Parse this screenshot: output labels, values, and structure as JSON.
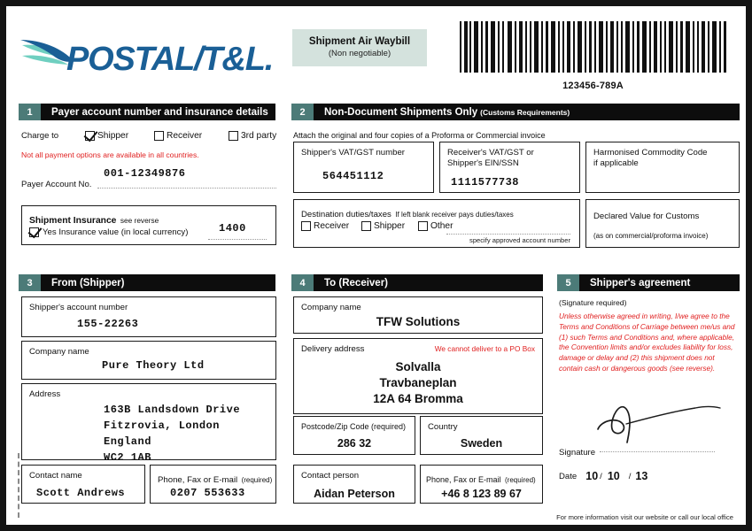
{
  "brand": {
    "name": "POSTAL/T&L.",
    "logo_icon": "wing-logo-icon",
    "blue": "#1a5f96",
    "teal": "#5ec4b6"
  },
  "header": {
    "badge_title": "Shipment Air Waybill",
    "badge_subtitle": "(Non negotiable)",
    "barcode_icon": "barcode-icon",
    "barcode_number": "123456-789A"
  },
  "colors": {
    "section_number_bg": "#4c7b78",
    "section_bar_bg": "#0d0d0d",
    "badge_bg": "#d4e2dd",
    "warning_red": "#e02020"
  },
  "section1": {
    "number": "1",
    "title": "Payer account number and insurance details",
    "charge_to_label": "Charge to",
    "charge_options": [
      {
        "label": "Shipper",
        "checked": true
      },
      {
        "label": "Receiver",
        "checked": false
      },
      {
        "label": "3rd party",
        "checked": false
      }
    ],
    "warning": "Not all payment options are available in all countries.",
    "payer_account_label": "Payer Account No.",
    "payer_account_value": "001-12349876",
    "insurance_title": "Shipment Insurance",
    "insurance_title_sub": "see reverse",
    "insurance_checkbox_checked": true,
    "insurance_option_label": "Yes Insurance value (in local currency)",
    "insurance_value": "1400"
  },
  "section2": {
    "number": "2",
    "title": "Non-Document Shipments Only",
    "title_sub": "(Customs Requirements)",
    "instruction": "Attach the original and four copies of a Proforma or Commercial invoice",
    "shipper_vat_label": "Shipper's VAT/GST number",
    "shipper_vat_value": "564451112",
    "receiver_vat_label_line1": "Receiver's VAT/GST or",
    "receiver_vat_label_line2": "Shipper's EIN/SSN",
    "receiver_vat_value": "1111577738",
    "commodity_label_line1": "Harmonised Commodity Code",
    "commodity_label_line2": "if applicable",
    "commodity_value": "",
    "duties_label": "Destination duties/taxes",
    "duties_label_sub": "If left blank receiver pays duties/taxes",
    "duties_options": [
      {
        "label": "Receiver",
        "checked": false
      },
      {
        "label": "Shipper",
        "checked": false
      },
      {
        "label": "Other",
        "checked": false
      }
    ],
    "duties_account_hint": "specify approved account number",
    "declared_label_line1": "Declared Value for Customs",
    "declared_label_line2": "(as on commercial/proforma invoice)",
    "declared_value": ""
  },
  "section3": {
    "number": "3",
    "title": "From (Shipper)",
    "account_label": "Shipper's account number",
    "account_value": "155-22263",
    "company_label": "Company name",
    "company_value": "Pure Theory Ltd",
    "address_label": "Address",
    "address_lines": [
      "163B Landsdown Drive",
      "Fitzrovia, London",
      "England",
      "WC2 1AB"
    ],
    "contact_label": "Contact name",
    "contact_value": "Scott Andrews",
    "phone_label": "Phone, Fax or E-mail",
    "phone_label_req": "(required)",
    "phone_value": "0207 553633"
  },
  "section4": {
    "number": "4",
    "title": "To (Receiver)",
    "company_label": "Company name",
    "company_value": "TFW Solutions",
    "address_label": "Delivery address",
    "address_warning": "We cannot deliver to a PO Box",
    "address_lines": [
      "Solvalla",
      "Travbaneplan",
      "12A 64 Bromma"
    ],
    "postcode_label": "Postcode/Zip Code (required)",
    "postcode_value": "286 32",
    "country_label": "Country",
    "country_value": "Sweden",
    "contact_label": "Contact person",
    "contact_value": "Aidan Peterson",
    "phone_label": "Phone, Fax or E-mail",
    "phone_label_req": "(required)",
    "phone_value": "+46 8 123 89 67"
  },
  "section5": {
    "number": "5",
    "title": "Shipper's agreement",
    "signature_required": "(Signature required)",
    "legal_text": "Unless otherwise agreed in writing, I/we agree to the Terms and Conditions of Carriage between me/us and (1) such Terms and Conditions and, where applicable, the Convention limits and/or excludes liability for loss, damage or delay and (2) this shipment does not contain cash or dangerous goods (see reverse).",
    "signature_icon": "handwritten-signature-icon",
    "signature_label": "Signature",
    "date_label": "Date",
    "date_day": "10",
    "date_month": "10",
    "date_year": "13",
    "date_sep": "/",
    "footer": "For more information visit our website or call our local office"
  }
}
